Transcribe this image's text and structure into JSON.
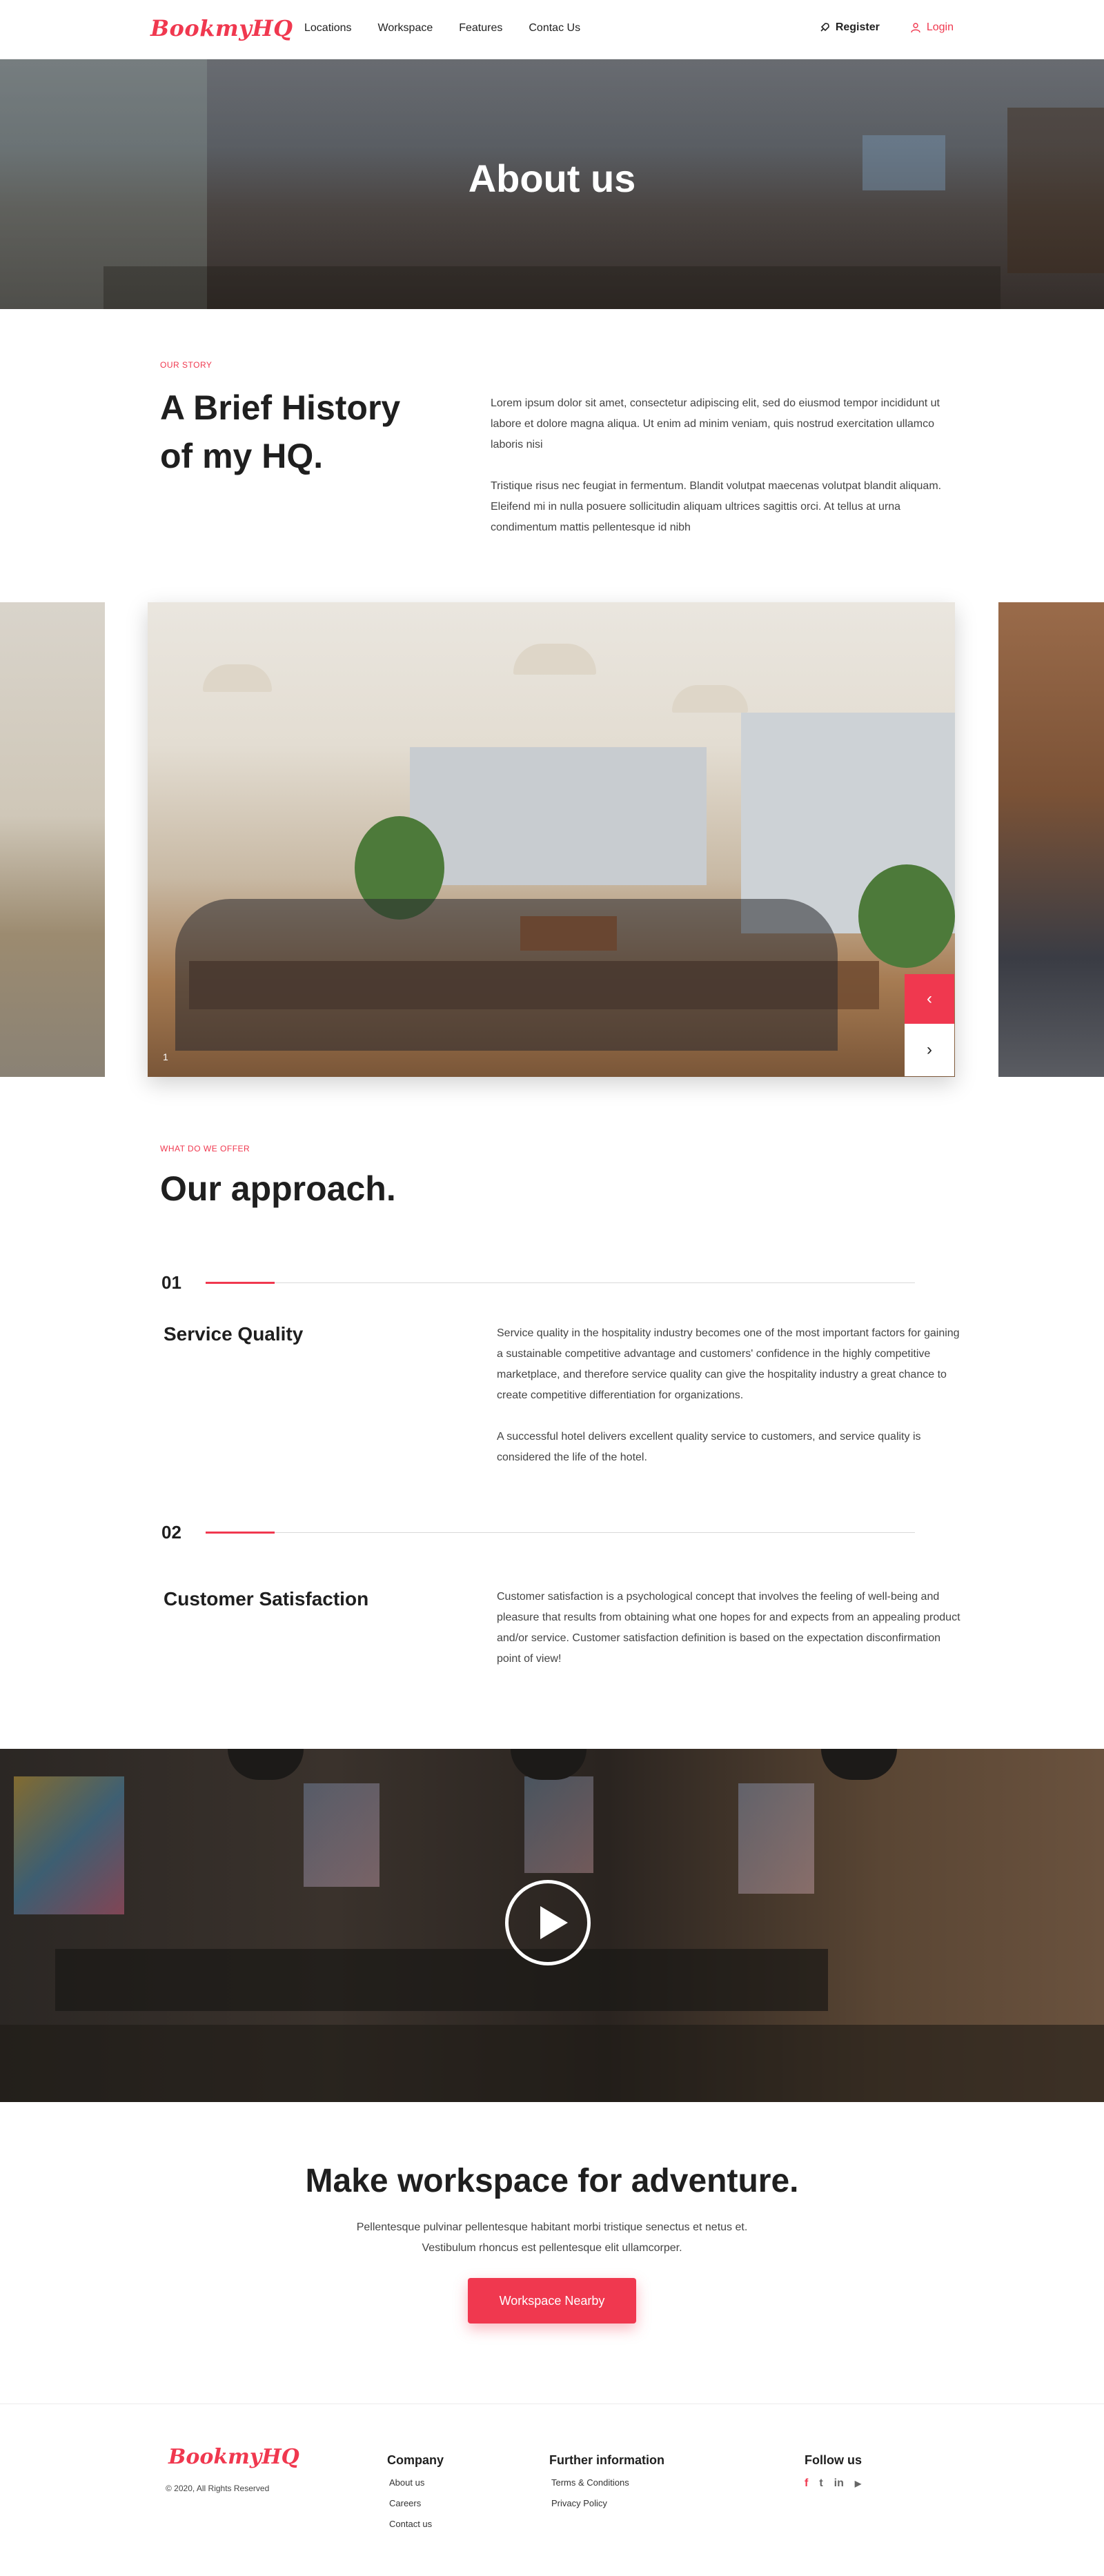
{
  "brand": {
    "logo_text": "BookmyHQ",
    "accent_color": "#f0384f"
  },
  "nav": {
    "items": [
      {
        "label": "Locations"
      },
      {
        "label": "Workspace"
      },
      {
        "label": "Features"
      },
      {
        "label": "Contac Us"
      }
    ],
    "register_label": "Register",
    "login_label": "Login"
  },
  "hero": {
    "title": "About us"
  },
  "story": {
    "eyebrow": "OUR STORY",
    "title": "A Brief History of my HQ.",
    "paragraphs": [
      "Lorem ipsum dolor sit amet, consectetur adipiscing elit, sed do eiusmod tempor incididunt ut labore et dolore magna aliqua. Ut enim ad minim veniam, quis nostrud exercitation ullamco laboris nisi",
      "Tristique risus nec feugiat in fermentum. Blandit volutpat maecenas volutpat blandit aliquam. Eleifend mi in nulla posuere sollicitudin aliquam ultrices sagittis orci. At tellus at urna condimentum mattis pellentesque id nibh"
    ]
  },
  "gallery": {
    "counter": "1",
    "prev_icon": "chevron-left-icon",
    "next_icon": "chevron-right-icon"
  },
  "approach": {
    "eyebrow": "WHAT DO WE OFFER",
    "title": "Our approach.",
    "steps": [
      {
        "number": "01",
        "title": "Service Quality",
        "paragraphs": [
          "Service quality in the hospitality industry becomes one of the most important factors for gaining a sustainable competitive advantage and customers' confidence in the highly competitive marketplace, and therefore service quality can give the hospitality industry a great chance to create competitive differentiation for organizations.",
          "A successful hotel delivers excellent quality service to customers, and service quality is considered the life of the hotel."
        ]
      },
      {
        "number": "02",
        "title": "Customer Satisfaction",
        "paragraphs": [
          "Customer satisfaction is a psychological concept that involves the feeling of well-being and pleasure that results from obtaining what one hopes for and expects from an appealing product and/or service. Customer satisfaction definition is based on the expectation disconfirmation point of view!"
        ]
      }
    ]
  },
  "video": {
    "play_icon": "play-icon"
  },
  "cta": {
    "title": "Make workspace for adventure.",
    "line1": "Pellentesque pulvinar pellentesque habitant morbi tristique senectus et netus et.",
    "line2": "Vestibulum rhoncus est pellentesque elit ullamcorper.",
    "button_label": "Workspace Nearby"
  },
  "footer": {
    "logo_text": "BookmyHQ",
    "copyright": "© 2020, All Rights Reserved",
    "company": {
      "heading": "Company",
      "links": [
        "About us",
        "Careers",
        "Contact us"
      ]
    },
    "further": {
      "heading": "Further information",
      "links": [
        "Terms & Conditions",
        "Privacy Policy"
      ]
    },
    "follow": {
      "heading": "Follow us",
      "icons": [
        "facebook-icon",
        "twitter-icon",
        "linkedin-icon",
        "youtube-icon"
      ],
      "glyphs": [
        "f",
        "t",
        "in",
        "▶"
      ]
    }
  }
}
